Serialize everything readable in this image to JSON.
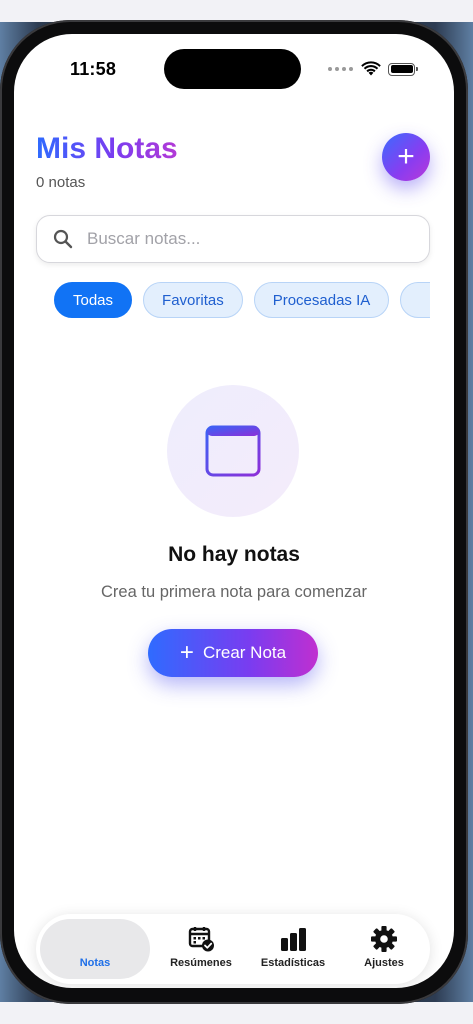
{
  "status": {
    "time": "11:58"
  },
  "header": {
    "title": "Mis Notas",
    "count": "0 notas",
    "add_icon": "plus-icon"
  },
  "search": {
    "placeholder": "Buscar notas..."
  },
  "filters": [
    "Todas",
    "Favoritas",
    "Procesadas IA"
  ],
  "empty": {
    "title": "No hay notas",
    "subtitle": "Crea tu primera nota para comenzar",
    "button": "Crear Nota",
    "icon": "note-icon"
  },
  "tabs": [
    {
      "label": "Notas",
      "icon": "notes-tab"
    },
    {
      "label": "Resúmenes",
      "icon": "calendar-check-icon"
    },
    {
      "label": "Estadísticas",
      "icon": "bar-chart-icon"
    },
    {
      "label": "Ajustes",
      "icon": "gear-icon"
    }
  ],
  "colors": {
    "accent": "#1173f5",
    "gradient_start": "#2f6bff",
    "gradient_end": "#c02fd0"
  }
}
